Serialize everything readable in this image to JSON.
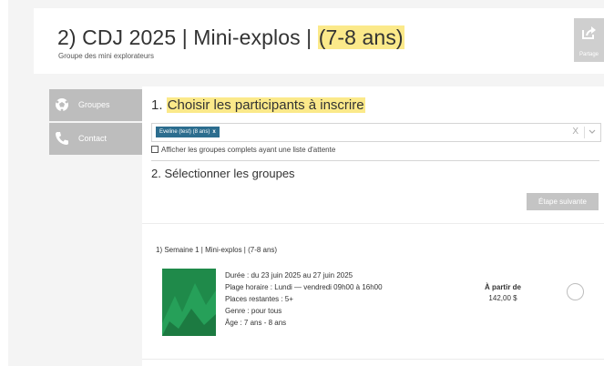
{
  "header": {
    "title_main": "2) CDJ 2025 | Mini-explos | ",
    "title_highlight": "(7-8 ans)",
    "subtitle": "Groupe des mini explorateurs",
    "share_label": "Partage"
  },
  "sidebar": {
    "items": [
      {
        "label": "Groupes",
        "icon": "soccer-ball-icon"
      },
      {
        "label": "Contact",
        "icon": "phone-icon"
      }
    ]
  },
  "step1": {
    "number": "1. ",
    "title": "Choisir les participants à inscrire",
    "selected_chip": "Eveline (test) (8 ans)",
    "chip_remove": "x",
    "clear": "X",
    "checkbox_label": "Afficher les groupes complets ayant une liste d'attente"
  },
  "step2": {
    "title": "2. Sélectionner les groupes",
    "next_button": "Étape suivante"
  },
  "group": {
    "title": "1) Semaine 1 | Mini-explos | (7-8 ans)",
    "duration": "Durée : du 23 juin 2025 au 27 juin 2025",
    "schedule": "Plage horaire : Lundi — vendredi 09h00 à 16h00",
    "places": "Places restantes : 5+",
    "gender": "Genre : pour tous",
    "age": "Âge : 7 ans - 8 ans",
    "price_label": "À partir de",
    "price_amount": "142,00 $"
  },
  "colors": {
    "highlight": "#fbe98a",
    "chip": "#2c6d8e",
    "sidebar": "#bdbdbd",
    "thumbnail": "#1f8a4a"
  }
}
